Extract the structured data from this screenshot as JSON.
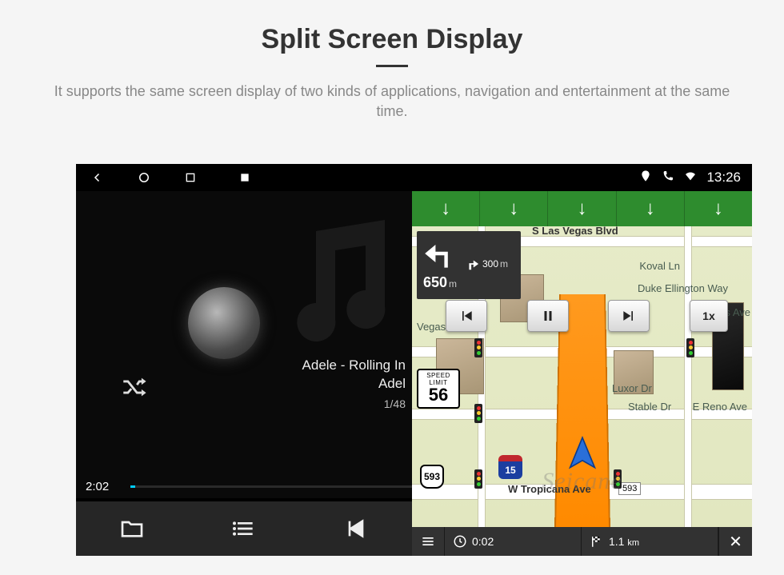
{
  "header": {
    "title": "Split Screen Display",
    "subtitle": "It supports the same screen display of two kinds of applications, navigation and entertainment at the same time."
  },
  "status_bar": {
    "time": "13:26"
  },
  "music": {
    "track_title": "Adele - Rolling In",
    "artist": "Adel",
    "track_index": "1/48",
    "elapsed": "2:02"
  },
  "nav": {
    "turn_distance": "650",
    "turn_unit": "m",
    "next_turn_distance": "300",
    "next_turn_unit": "m",
    "speed_limit_label": "SPEED LIMIT",
    "speed_limit": "56",
    "playback_speed": "1x",
    "route_shield_us": "593",
    "route_shield_interstate": "15",
    "eta": "0:02",
    "remaining_distance": "1.1",
    "remaining_unit": "km",
    "streets": {
      "top": "S Las Vegas Blvd",
      "right1": "Koval Ln",
      "right2": "Duke Ellington Way",
      "right3": "E Reno Ave",
      "left1": "Vegas Blvd",
      "center1": "Luxor Dr",
      "center2": "Stable Dr",
      "bottom": "W Tropicana Ave",
      "bottom_ref": "593",
      "far_right": "iles Ave"
    }
  },
  "watermark": "Seicane"
}
